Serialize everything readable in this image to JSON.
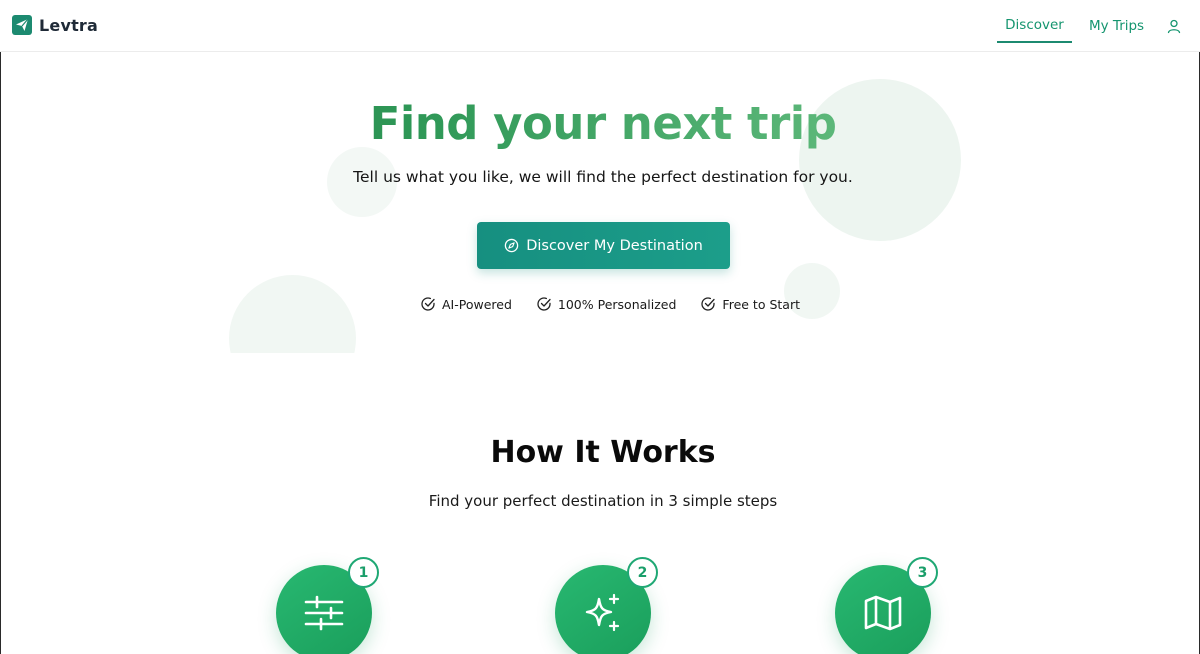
{
  "app": {
    "name": "Levtra",
    "logo_icon": "paper-plane-icon"
  },
  "nav": {
    "discover": "Discover",
    "my_trips": "My Trips",
    "user_icon": "user-icon",
    "active": "Discover"
  },
  "hero": {
    "title": "Find your next trip",
    "subtitle": "Tell us what you like, we will find the perfect destination for you.",
    "cta_label": "Discover My Destination",
    "cta_icon": "compass-icon",
    "features": [
      {
        "label": "AI-Powered",
        "icon": "check-circle-icon"
      },
      {
        "label": "100% Personalized",
        "icon": "check-circle-icon"
      },
      {
        "label": "Free to Start",
        "icon": "check-circle-icon"
      }
    ]
  },
  "how_it_works": {
    "title": "How It Works",
    "subtitle": "Find your perfect destination in 3 simple steps",
    "steps": [
      {
        "number": "1",
        "icon": "sliders-icon"
      },
      {
        "number": "2",
        "icon": "sparkles-icon"
      },
      {
        "number": "3",
        "icon": "map-icon"
      }
    ]
  },
  "colors": {
    "accent": "#1c8a70",
    "cta": "#168f80",
    "step_green": "#22aa66",
    "title_gradient_start": "#1f7c43",
    "title_gradient_end": "#7cc991"
  }
}
